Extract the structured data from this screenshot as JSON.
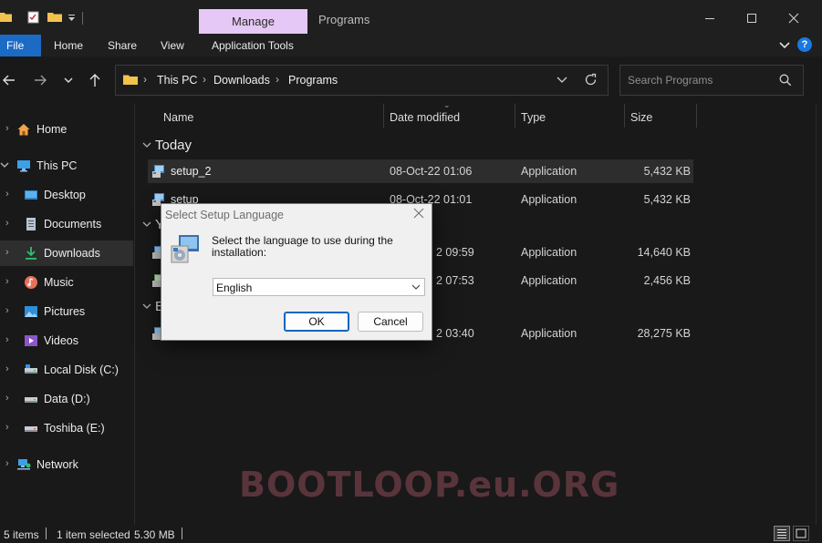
{
  "window": {
    "contextual_tab": "Manage",
    "contextual_title": "Programs",
    "minimize_icon": "minimize-icon",
    "maximize_icon": "maximize-icon",
    "close_icon": "close-icon"
  },
  "ribbon": {
    "tabs": [
      "File",
      "Home",
      "Share",
      "View",
      "Application Tools"
    ],
    "help_label": "?"
  },
  "address": {
    "crumbs": [
      "This PC",
      "Downloads",
      "Programs"
    ],
    "search_placeholder": "Search Programs"
  },
  "sidebar": {
    "items": [
      {
        "label": "Home",
        "icon": "home-icon"
      },
      {
        "label": "This PC",
        "icon": "monitor-icon"
      },
      {
        "label": "Desktop",
        "icon": "desktop-icon"
      },
      {
        "label": "Documents",
        "icon": "documents-icon"
      },
      {
        "label": "Downloads",
        "icon": "download-icon"
      },
      {
        "label": "Music",
        "icon": "music-icon"
      },
      {
        "label": "Pictures",
        "icon": "pictures-icon"
      },
      {
        "label": "Videos",
        "icon": "videos-icon"
      },
      {
        "label": "Local Disk (C:)",
        "icon": "drive-icon"
      },
      {
        "label": "Data (D:)",
        "icon": "drive-icon"
      },
      {
        "label": "Toshiba (E:)",
        "icon": "drive-icon"
      },
      {
        "label": "Network",
        "icon": "network-icon"
      }
    ]
  },
  "files": {
    "columns": [
      "Name",
      "Date modified",
      "Type",
      "Size"
    ],
    "groups": [
      "Today",
      "Y",
      "E"
    ],
    "rows": [
      {
        "name": "setup_2",
        "date": "08-Oct-22 01:06",
        "type": "Application",
        "size": "5,432 KB"
      },
      {
        "name": "setup",
        "date": "08-Oct-22 01:01",
        "type": "Application",
        "size": "5,432 KB"
      },
      {
        "name": "",
        "date": "2 09:59",
        "type": "Application",
        "size": "14,640 KB"
      },
      {
        "name": "",
        "date": "2 07:53",
        "type": "Application",
        "size": "2,456 KB"
      },
      {
        "name": "",
        "date": "2 03:40",
        "type": "Application",
        "size": "28,275 KB"
      }
    ]
  },
  "status": {
    "item_count": "5 items",
    "selection": "1 item selected",
    "selection_size": "5.30 MB"
  },
  "dialog": {
    "title": "Select Setup Language",
    "prompt": "Select the language to use during the installation:",
    "selected_language": "English",
    "ok_label": "OK",
    "cancel_label": "Cancel"
  },
  "watermark": "BOOTLOOP.eu.ORG",
  "colors": {
    "accent": "#1b6ac4",
    "contextual_tab": "#e5c8f5",
    "background": "#191919",
    "dialog": "#f0f0f0",
    "watermark": "#6b3b44"
  }
}
